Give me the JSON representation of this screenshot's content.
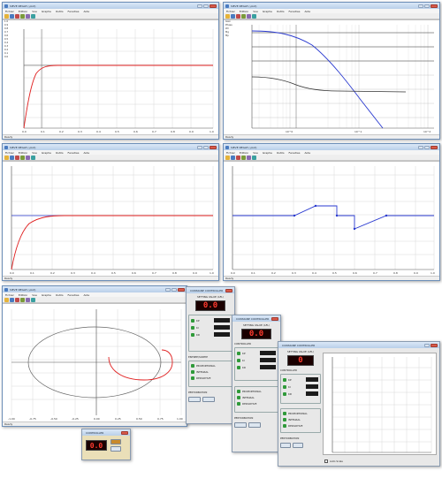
{
  "app_title": "SIEVE REGLE (.plot)",
  "menu": [
    "Fichier",
    "Edition",
    "Vue",
    "Graphe",
    "Outils",
    "Fenetres",
    "Aide"
  ],
  "status": "Ready",
  "windows": {
    "step1": {
      "title": "SIEVE REGLE (.plot)",
      "legend": [
        "1.0",
        "0.9",
        "0.8",
        "0.7",
        "0.6",
        "0.5",
        "0.4",
        "0.3",
        "0.2",
        "0.1",
        "0.0"
      ],
      "x_ticks": [
        "0.0",
        "0.1",
        "0.2",
        "0.3",
        "0.4",
        "0.5",
        "0.6",
        "0.7",
        "0.8",
        "0.9",
        "1.0"
      ]
    },
    "bode": {
      "title": "SIEVE REGLE (.plot)",
      "legend": [
        "Gain",
        "Phase",
        "Wc",
        "Mg",
        "Mp"
      ],
      "x_ticks": [
        "10^0",
        "10^1",
        "10^2",
        "10^3"
      ]
    },
    "step2": {
      "title": "SIEVE REGLE (.plot)",
      "x_ticks": [
        "0.0",
        "0.1",
        "0.2",
        "0.3",
        "0.4",
        "0.5",
        "0.6",
        "0.7",
        "0.8",
        "0.9",
        "1.0"
      ]
    },
    "setpoint": {
      "title": "SIEVE REGLE (.plot)",
      "x_ticks": [
        "0.0",
        "0.1",
        "0.2",
        "0.3",
        "0.4",
        "0.5",
        "0.6",
        "0.7",
        "0.8",
        "0.9",
        "1.0"
      ]
    },
    "nyquist": {
      "title": "SIEVE REGLE (.plot)",
      "x_ticks": [
        "-1.00",
        "-0.75",
        "-0.50",
        "-0.25",
        "0.00",
        "0.25",
        "0.50",
        "0.75",
        "1.00"
      ]
    }
  },
  "controllers": {
    "c1": {
      "title": "CONSIGNE CONTROLLER",
      "header": "SETTING VALUE (AFL)",
      "display": "0.0",
      "rows": [
        "KP",
        "KI",
        "KD"
      ],
      "section": "ENTREE/SORTIE",
      "options": [
        "PROPORTIONAL",
        "INTEGRAL",
        "DERIVATIVE"
      ],
      "footer": "PERTURBATION"
    },
    "c2": {
      "title": "CONSIGNE CONTROLLER",
      "header": "SETTING VALUE (AFL)",
      "display": "0.0",
      "rows": [
        "KP",
        "KI",
        "KD"
      ],
      "section": "CONTROLLER",
      "options": [
        "PROPORTIONAL",
        "INTEGRAL",
        "DERIVATIVE"
      ],
      "footer": "PERTURBATION"
    },
    "c3": {
      "title": "CONSIGNE CONTROLLER",
      "header": "SETTING VALUE (AFL)",
      "display": "0",
      "rows": [
        "KP",
        "KI",
        "KD"
      ],
      "section": "CONTROLLER",
      "options": [
        "PROPORTIONAL",
        "INTEGRAL",
        "DERIVATIVE"
      ],
      "footer": "PERTURBATION",
      "checkbox": "Auto Scale"
    }
  },
  "mini": {
    "title": "CONTROLLER",
    "display": "0.0"
  }
}
